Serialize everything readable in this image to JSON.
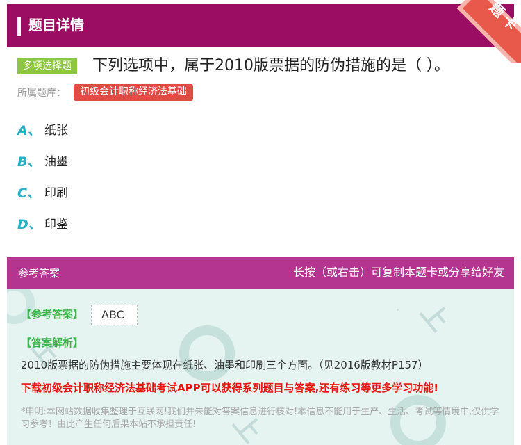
{
  "header": {
    "title": "题目详情",
    "ribbon_label": "题卡"
  },
  "question": {
    "type_badge": "多项选择题",
    "text": "下列选项中，属于2010版票据的防伪措施的是（ ）。",
    "bank_label": "所属题库：",
    "bank_name": "初级会计职称经济法基础"
  },
  "options": [
    {
      "letter": "A、",
      "text": "纸张"
    },
    {
      "letter": "B、",
      "text": "油墨"
    },
    {
      "letter": "C、",
      "text": "印刷"
    },
    {
      "letter": "D、",
      "text": "印鉴"
    }
  ],
  "answer": {
    "section_title": "参考答案",
    "share_hint": "长按（或右击）可复制本题卡或分享给好友",
    "ref_label": "【参考答案】",
    "ref_value": "ABC",
    "analysis_label": "【答案解析】",
    "analysis_text": "2010版票据的防伪措施主要体现在纸张、油墨和印刷三个方面。（见2016版教材P157）",
    "promo_text": "下载初级会计职称经济法基础考试APP可以获得系列题目与答案,还有练习等更多学习功能!",
    "disclaimer": "*申明:本网站数据收集整理于互联网!我们并未能对答案信息进行核对!本信息不能用于生产、生活、考试等情境中,仅供学习参考！由此产生任何后果本站不承担责任!"
  },
  "colors": {
    "header_bg": "#9b0d63",
    "answer_head_bg": "#b4358f",
    "answer_body_bg": "#e5f3f1",
    "badge_green": "#8dc63f",
    "badge_red": "#e04b44",
    "option_letter": "#27b0c8",
    "promo_red": "#e8140f"
  }
}
